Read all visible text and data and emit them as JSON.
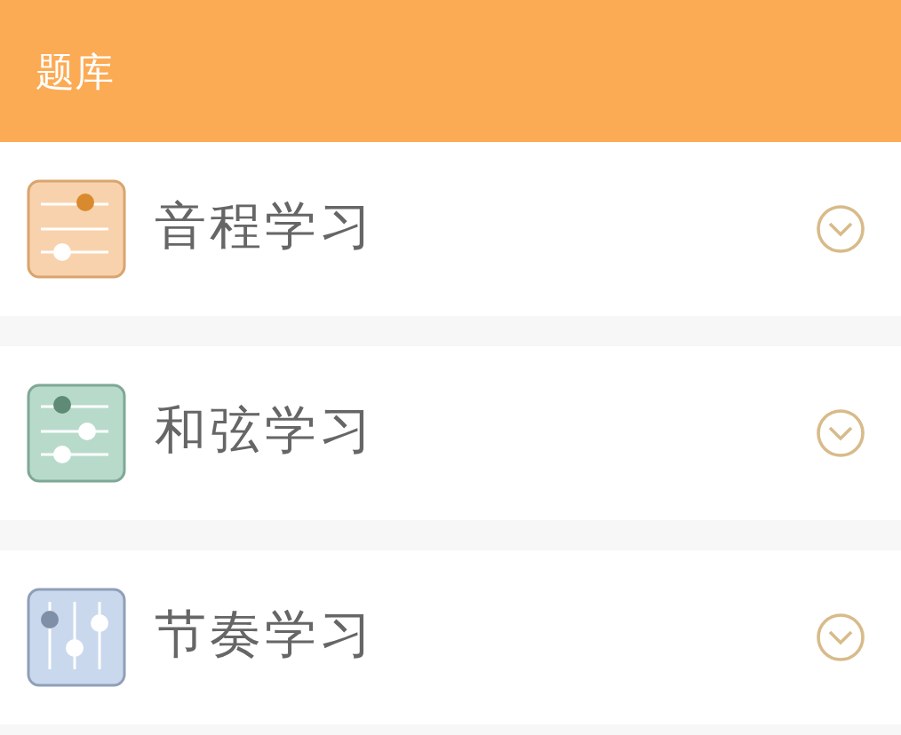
{
  "header": {
    "title": "题库"
  },
  "sections": [
    {
      "label": "音程学习",
      "kind": "horizontal",
      "color": "#f8d2ac",
      "expanded": false
    },
    {
      "label": "和弦学习",
      "kind": "horizontal-three",
      "color": "#b7dacb",
      "expanded": false
    },
    {
      "label": "节奏学习",
      "kind": "vertical",
      "color": "#c9d8ec",
      "expanded": false
    }
  ]
}
